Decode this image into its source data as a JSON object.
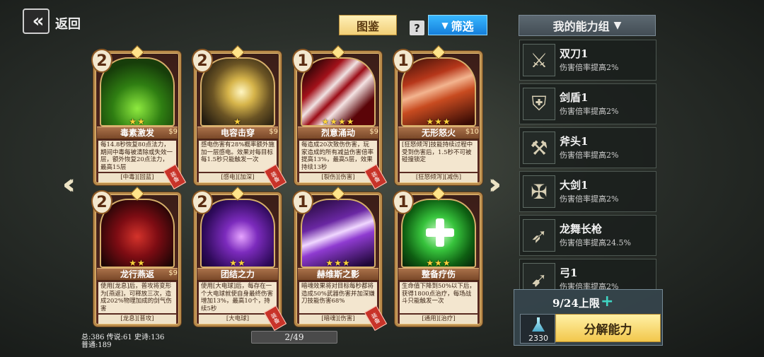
{
  "header": {
    "back_icon": "double-chevron-left",
    "back_label": "返回",
    "tujian_label": "图鉴",
    "help_label": "?",
    "filter_label": "筛选",
    "my_group_label": "我的能力组"
  },
  "cards": [
    {
      "cost": "2",
      "stars": "★★",
      "name": "毒素激发",
      "price": "$9",
      "desc": "每14.8秒恢复80点法力，期间中毒每被清除或失效一层，额外恢复20点法力，最高15层",
      "tags": "[中毒][回蓝]",
      "equipped": "装备",
      "art": "art-green"
    },
    {
      "cost": "2",
      "stars": "★",
      "name": "电容击穿",
      "price": "$9",
      "desc": "感电伤害有28%概率额外施加一层感电。效果对每目标每1.5秒只能触发一次",
      "tags": "[感电][加深]",
      "equipped": "装备",
      "art": "art-gold"
    },
    {
      "cost": "1",
      "stars": "★★★★",
      "name": "烈意涌动",
      "price": "$9",
      "desc": "每造成20次致伤伤害，玩家造成的所有减益伤害倍率提高13%，最高5层，效果持续13秒",
      "tags": "[裂伤][伤害]",
      "equipped": "装备",
      "art": "art-red"
    },
    {
      "cost": "1",
      "stars": "★★★",
      "name": "无形怒火",
      "price": "$10",
      "desc": "[狂怒倾泻]技能持续过程中受到伤害后，1.5秒不可被碰撞锁定",
      "tags": "[狂怒倾泻][减伤]",
      "equipped": "",
      "art": "art-orange"
    },
    {
      "cost": "2",
      "stars": "★★",
      "name": "龙行燕返",
      "price": "$9",
      "desc": "使用[龙息]后，普攻将变形为[燕返]，可释放三次，造成202%物理加成的剑气伤害",
      "tags": "[龙息][普攻]",
      "equipped": "",
      "art": "art-dragon"
    },
    {
      "cost": "2",
      "stars": "★★",
      "name": "团结之力",
      "price": "",
      "desc": "使用[大电球]后，每存在一个大电球就使自身最终伤害增加13%，最高10个，持续5秒",
      "tags": "[大电球]",
      "equipped": "装备",
      "art": "art-purple"
    },
    {
      "cost": "1",
      "stars": "★★★",
      "name": "赫维斯之影",
      "price": "",
      "desc": "暗魂效果将对目标每秒都将造成50%武器伤害并加深嫌刀技能伤害68%",
      "tags": "[暗魂][伤害]",
      "equipped": "装备",
      "art": "art-violet"
    },
    {
      "cost": "1",
      "stars": "★★★",
      "name": "整备疗伤",
      "price": "",
      "desc": "生命值下降到50%以下后，获得1800点治疗，每场战斗只能触发一次",
      "tags": "[通用][治疗]",
      "equipped": "",
      "art": "art-heal"
    }
  ],
  "stats": {
    "line1": "总:386 传说:61 史诗:136",
    "line2": "普通:189"
  },
  "pager": "2/49",
  "groups": [
    {
      "icon": "crossed-swords-icon",
      "glyph": "⚔",
      "name": "双刀1",
      "sub": "伤害倍率提高2%"
    },
    {
      "icon": "shield-icon",
      "glyph": "⛨",
      "name": "剑盾1",
      "sub": "伤害倍率提高2%"
    },
    {
      "icon": "axe-icon",
      "glyph": "⚒",
      "name": "斧头1",
      "sub": "伤害倍率提高2%"
    },
    {
      "icon": "greatsword-icon",
      "glyph": "✠",
      "name": "大剑1",
      "sub": "伤害倍率提高2%"
    },
    {
      "icon": "spear-icon",
      "glyph": "➶",
      "name": "龙舞长枪",
      "sub": "伤害倍率提高24.5%"
    },
    {
      "icon": "bow-icon",
      "glyph": "➹",
      "name": "弓1",
      "sub": "伤害倍率提高2%"
    }
  ],
  "limit_label": "9/24上限",
  "resource_value": "2330",
  "decompose_label": "分解能力"
}
